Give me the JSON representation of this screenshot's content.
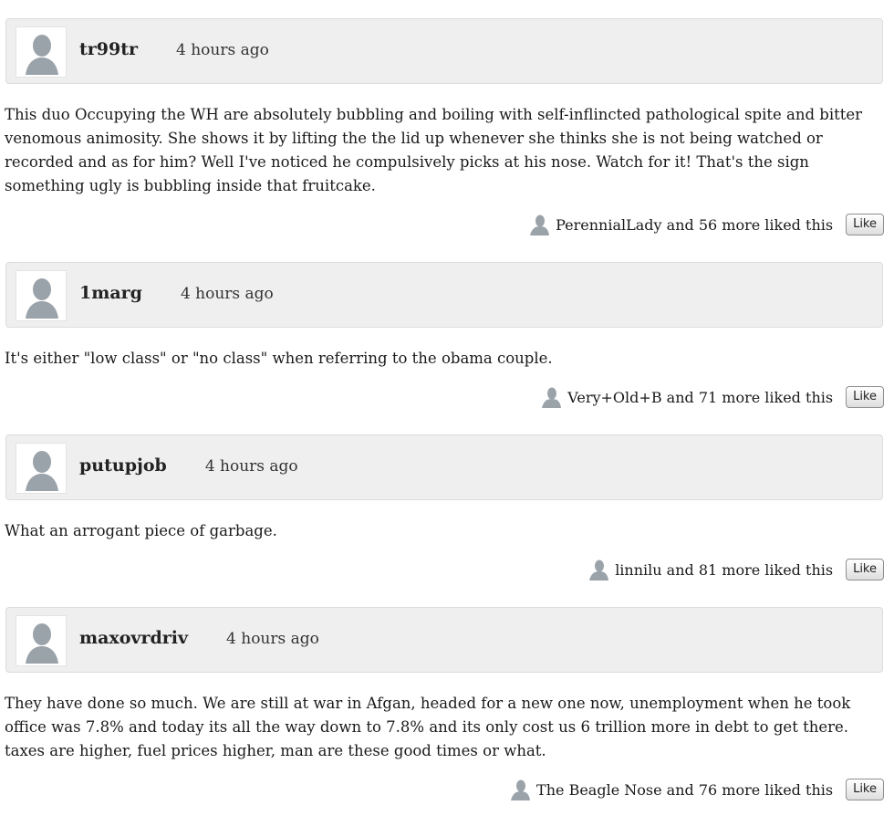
{
  "comments": [
    {
      "username": "tr99tr",
      "timestamp": "4 hours ago",
      "body": "This duo Occupying the WH are absolutely bubbling and boiling with self-inflincted pathological spite and bitter venomous animosity.  She shows it by lifting the the lid up whenever she thinks she is not being watched or recorded and as for him?  Well I've noticed he compulsively picks at his nose.  Watch for it!  That's the sign something ugly is bubbling inside that fruitcake.",
      "liked_by": "PerennialLady and 56 more liked this",
      "like_label": "Like"
    },
    {
      "username": "1marg",
      "timestamp": "4 hours ago",
      "body": "It's either \"low class\" or \"no class\" when referring to the obama couple.",
      "liked_by": "Very+Old+B and 71 more liked this",
      "like_label": "Like"
    },
    {
      "username": "putupjob",
      "timestamp": "4 hours ago",
      "body": "What an arrogant piece of garbage.",
      "liked_by": "linnilu and 81 more liked this",
      "like_label": "Like"
    },
    {
      "username": "maxovrdriv",
      "timestamp": "4 hours ago",
      "body": "They have done so much.  We are still at war in Afgan, headed for a new one now, unemployment when he took office was 7.8% and today its all the way down to 7.8% and its only cost us 6 trillion more in debt to get there.  taxes are higher, fuel prices higher, man are these good times or what.",
      "liked_by": "The Beagle Nose and 76 more liked this",
      "like_label": "Like"
    }
  ],
  "icons": {
    "avatar": "default-avatar-silhouette-icon"
  },
  "colors": {
    "header_background": "#efefef",
    "avatar_silhouette": "#9aa2aa"
  }
}
